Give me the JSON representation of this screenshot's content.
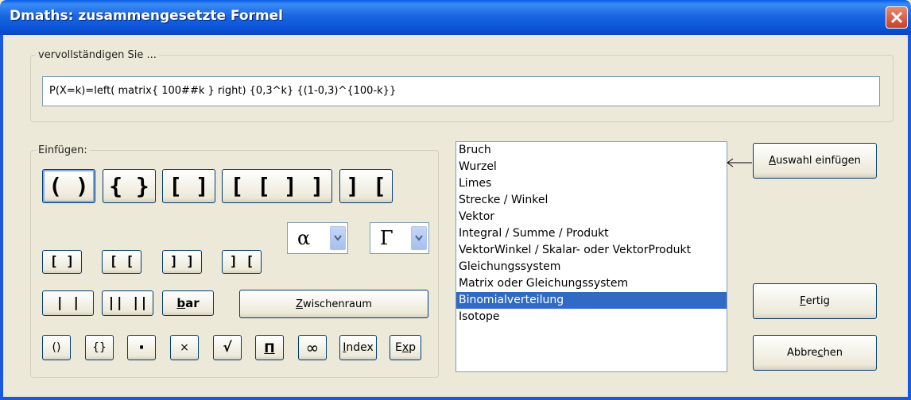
{
  "window": {
    "title": "Dmaths: zusammengesetzte Formel"
  },
  "complete_group": {
    "legend": "vervollständigen Sie ...",
    "formula": "P(X=k)=left( matrix{ 100##k } right) {0,3^k} {(1-0,3)^{100-k}}"
  },
  "insert_group": {
    "legend": "Einfügen:",
    "big_buttons": [
      "( )",
      "{ }",
      "[ ]",
      "[ [   ] ]",
      "] ["
    ],
    "alpha_select": {
      "value": "α"
    },
    "gamma_select": {
      "value": "Γ"
    },
    "small_buttons": [
      "[ ]",
      "[ [",
      "] ]",
      "] ["
    ],
    "norm_buttons": [
      "| |",
      "|| ||"
    ],
    "bar_button": {
      "underline": "b",
      "rest": "ar"
    },
    "space_button": {
      "underline": "Z",
      "rest": "wischenraum"
    },
    "bottom_buttons": [
      "()",
      "{}",
      "·",
      "×",
      "√",
      "Π",
      "∞"
    ],
    "index_button": {
      "underline": "I",
      "rest": "ndex"
    },
    "exp_button": {
      "first": "E",
      "underline": "x",
      "rest": "p"
    }
  },
  "listbox": {
    "items": [
      "Bruch",
      "Wurzel",
      "Limes",
      "Strecke / Winkel",
      "Vektor",
      "Integral / Summe / Produkt",
      "VektorWinkel / Skalar- oder VektorProdukt",
      "Gleichungssystem",
      "Matrix oder Gleichungssystem",
      "Binomialverteilung",
      "Isotope"
    ],
    "selected_index": 9
  },
  "actions": {
    "insert_selection": {
      "underline": "A",
      "rest": "uswahl einfügen"
    },
    "done": {
      "underline": "F",
      "rest": "ertig"
    },
    "cancel": {
      "first": "Abbre",
      "underline": "c",
      "rest": "hen"
    }
  },
  "colors": {
    "titlebar": "#0b54d8",
    "selection": "#316ac5",
    "dialog": "#ece9d8"
  }
}
